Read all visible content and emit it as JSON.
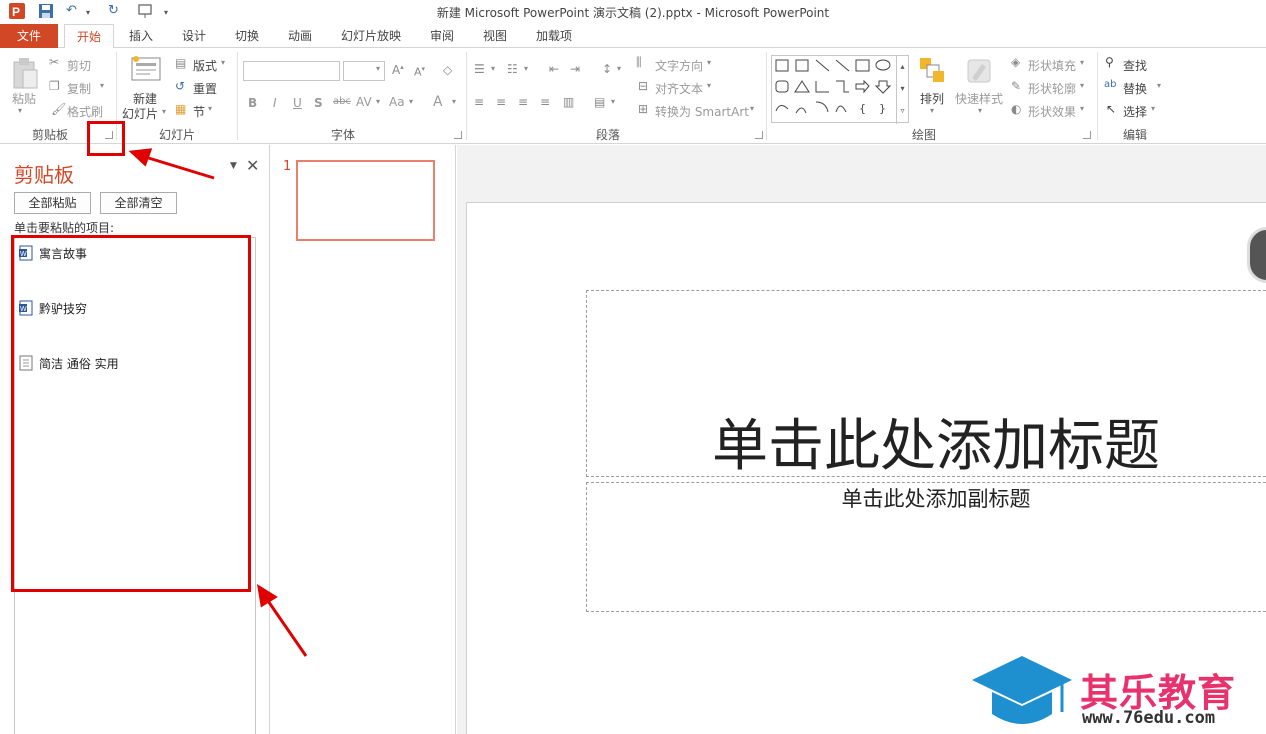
{
  "titlebar": {
    "title": "新建 Microsoft PowerPoint 演示文稿 (2).pptx - Microsoft PowerPoint"
  },
  "tabs": [
    "文件",
    "开始",
    "插入",
    "设计",
    "切换",
    "动画",
    "幻灯片放映",
    "审阅",
    "视图",
    "加载项"
  ],
  "ribbon": {
    "clipboard": {
      "paste": "粘贴",
      "cut": "剪切",
      "copy": "复制",
      "format_painter": "格式刷",
      "label": "剪贴板"
    },
    "slides": {
      "new_slide": "新建",
      "new_slide2": "幻灯片",
      "layout": "版式",
      "reset": "重置",
      "section": "节",
      "label": "幻灯片"
    },
    "font": {
      "label": "字体",
      "bold": "B",
      "italic": "I",
      "underline": "U",
      "shadow": "S",
      "strike": "abc",
      "spacing": "AV",
      "case": "Aa",
      "color": "A"
    },
    "paragraph": {
      "text_direction": "文字方向",
      "align_text": "对齐文本",
      "smartart": "转换为 SmartArt",
      "label": "段落"
    },
    "drawing": {
      "arrange": "排列",
      "quick_styles": "快速样式",
      "shape_fill": "形状填充",
      "shape_outline": "形状轮廓",
      "shape_effects": "形状效果",
      "label": "绘图"
    },
    "editing": {
      "find": "查找",
      "replace": "替换",
      "select": "选择",
      "label": "编辑"
    }
  },
  "clipboard_pane": {
    "title": "剪贴板",
    "paste_all": "全部粘贴",
    "clear_all": "全部清空",
    "hint": "单击要粘贴的项目:",
    "items": [
      "寓言故事",
      "黔驴技穷",
      "简洁 通俗 实用"
    ]
  },
  "thumbnails": {
    "number": "1"
  },
  "slide": {
    "title_placeholder": "单击此处添加标题",
    "subtitle_placeholder": "单击此处添加副标题"
  },
  "watermark": {
    "name": "其乐教育",
    "url": "www.76edu.com"
  },
  "colors": {
    "accent": "#d24726",
    "annotation": "#e00000",
    "watermark_pink": "#e8326e",
    "watermark_blue": "#1e8fcf"
  }
}
